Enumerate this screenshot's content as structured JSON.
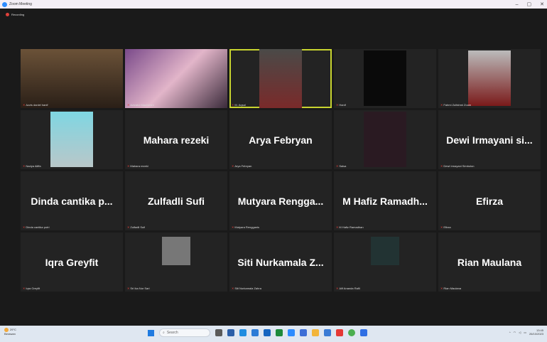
{
  "window": {
    "title": "Zoom Meeting",
    "controls": [
      "–",
      "▢",
      "✕"
    ]
  },
  "recording": {
    "label": "Recording"
  },
  "participants": [
    {
      "id": "p1",
      "label": "Azzis daniel hanif",
      "type": "video",
      "bg": "#4a3a2a"
    },
    {
      "id": "p2",
      "label": "Azizatul Maulidhini",
      "type": "video",
      "bg": "#5a3a6a"
    },
    {
      "id": "p3",
      "label": "M. Aqsal",
      "type": "video",
      "bg": "#3a3a3a",
      "active": true
    },
    {
      "id": "p4",
      "label": "Hanif",
      "type": "video",
      "bg": "#0a0a0a"
    },
    {
      "id": "p5",
      "label": "Fahmi Zulfahmi Zoom",
      "type": "video",
      "bg": "#888"
    },
    {
      "id": "p6",
      "label": "Nadya Aliffa",
      "type": "video",
      "bg": "#6fd0e0"
    },
    {
      "id": "p7",
      "label": "Mahara rezeki",
      "name": "Mahara rezeki",
      "type": "name"
    },
    {
      "id": "p8",
      "label": "Arya Febryan",
      "name": "Arya Febryan",
      "type": "name"
    },
    {
      "id": "p9",
      "label": "Salsa",
      "type": "video",
      "bg": "#2a1a22"
    },
    {
      "id": "p10",
      "label": "Dewi Irmayani Simbolon",
      "name": "Dewi Irmayani si...",
      "type": "name"
    },
    {
      "id": "p11",
      "label": "Dinda cantika putri",
      "name": "Dinda cantika p...",
      "type": "name"
    },
    {
      "id": "p12",
      "label": "Zulfadli Sufi",
      "name": "Zulfadli Sufi",
      "type": "name"
    },
    {
      "id": "p13",
      "label": "Mutyara Rengganis",
      "name": "Mutyara Rengga...",
      "type": "name"
    },
    {
      "id": "p14",
      "label": "M Hafiz Ramadhan",
      "name": "M Hafiz Ramadh...",
      "type": "name"
    },
    {
      "id": "p15",
      "label": "Efirza",
      "name": "Efirza",
      "type": "name"
    },
    {
      "id": "p16",
      "label": "Iqra Greyfit",
      "name": "Iqra Greyfit",
      "type": "name"
    },
    {
      "id": "p17",
      "label": "Sri Ika Nur Sari",
      "type": "photo",
      "bg": "#777"
    },
    {
      "id": "p18",
      "label": "Siti Nurkamala Zahra",
      "name": "Siti Nurkamala Z...",
      "type": "name"
    },
    {
      "id": "p19",
      "label": "Alif Ananda Rafli",
      "type": "photo",
      "bg": "#233"
    },
    {
      "id": "p20",
      "label": "Rian Maulana",
      "name": "Rian Maulana",
      "type": "name"
    }
  ],
  "taskbar": {
    "weather_temp": "29°C",
    "weather_desc": "Berawan",
    "search_placeholder": "Search",
    "time": "13:45",
    "date": "26/10/2023"
  }
}
